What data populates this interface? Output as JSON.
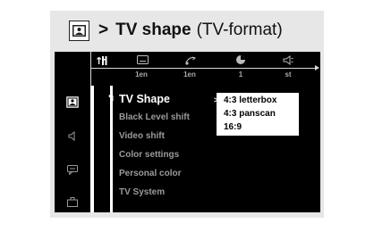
{
  "heading": {
    "arrow": ">",
    "title": "TV shape",
    "subtitle": "(TV-format)",
    "icon": "tv-screen-icon"
  },
  "topbar": {
    "icons": [
      "tools-icon",
      "subtitle-icon",
      "audio-icon",
      "angle-icon",
      "speaker-icon"
    ],
    "values": [
      "1en",
      "1en",
      "1",
      "st"
    ]
  },
  "sidebar": {
    "items": [
      "tv-screen-icon",
      "speaker-icon",
      "speech-bubble-icon",
      "briefcase-icon"
    ]
  },
  "menu": {
    "items": [
      "TV Shape",
      "Black Level shift",
      "Video shift",
      "Color settings",
      "Personal color",
      "TV System"
    ]
  },
  "dropdown": {
    "options": [
      "4:3 letterbox",
      "4:3 panscan",
      "16:9"
    ]
  },
  "colors": {
    "screen_bg": "#000000",
    "panel_bg": "#e7e7e7",
    "inactive_text": "#9a9a9a"
  }
}
